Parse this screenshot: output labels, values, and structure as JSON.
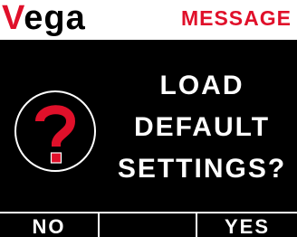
{
  "header": {
    "brand_first_letter": "V",
    "brand_rest": "ega",
    "title": "MESSAGE"
  },
  "dialog": {
    "icon": "question-circle-icon",
    "lines": [
      "LOAD",
      "DEFAULT",
      "SETTINGS?"
    ]
  },
  "softkeys": {
    "key1": "NO",
    "key2": "",
    "key3": "YES"
  },
  "colors": {
    "accent_red": "#e0102a",
    "background": "#000000",
    "header_bg": "#ffffff",
    "text": "#ffffff"
  }
}
